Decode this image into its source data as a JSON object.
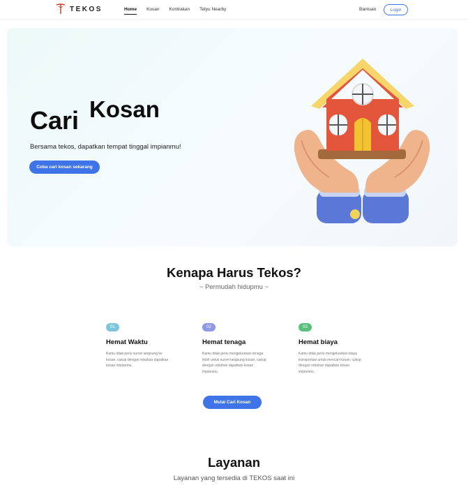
{
  "brand": {
    "name": "TEKOS",
    "logo_icon": "tekos-logo-icon"
  },
  "nav": {
    "links": [
      {
        "label": "Home",
        "active": true
      },
      {
        "label": "Kosan",
        "active": false
      },
      {
        "label": "Kontrakan",
        "active": false
      },
      {
        "label": "Tetyu Nearby",
        "active": false
      }
    ],
    "help_label": "Bantuan",
    "login_label": "Login"
  },
  "hero": {
    "title_part1": "Cari",
    "title_part2": "Kosan",
    "subtitle": "Bersama tekos, dapatkan tempat tinggal impianmu!",
    "cta_label": "Coba cari kosan sekarang",
    "illustration": "house-in-hands-illustration"
  },
  "why": {
    "title": "Kenapa Harus Tekos?",
    "subtitle": "~ Permudah hidupmu ~",
    "features": [
      {
        "badge": "01",
        "badge_color": "#7cc6dc",
        "title": "Hemat Waktu",
        "desc": "Kamu tidak perlu survei langsung ke kosan, cukup dengan rebahan dapatkan kosan impianmu."
      },
      {
        "badge": "02",
        "badge_color": "#8f98e6",
        "title": "Hemat tenaga",
        "desc": "Kamu tidak perlu mengeluarkan tenaga lebih untuk survei langsung kosan, cukup dengan rebahan dapatkan kosan impianmu."
      },
      {
        "badge": "03",
        "badge_color": "#58c07a",
        "title": "Hemat biaya",
        "desc": "Kamu tidak perlu mengeluarkan biaya transportasi untuk mencari kosan, cukup dengan rebahan dapatkan kosan impianmu."
      }
    ],
    "cta_label": "Mulai Cari Kosan"
  },
  "services": {
    "title": "Layanan",
    "subtitle": "Layanan yang tersedia di TEKOS saat ini"
  },
  "colors": {
    "primary": "#3f73e8",
    "hero_bg": "#edfaf8"
  }
}
